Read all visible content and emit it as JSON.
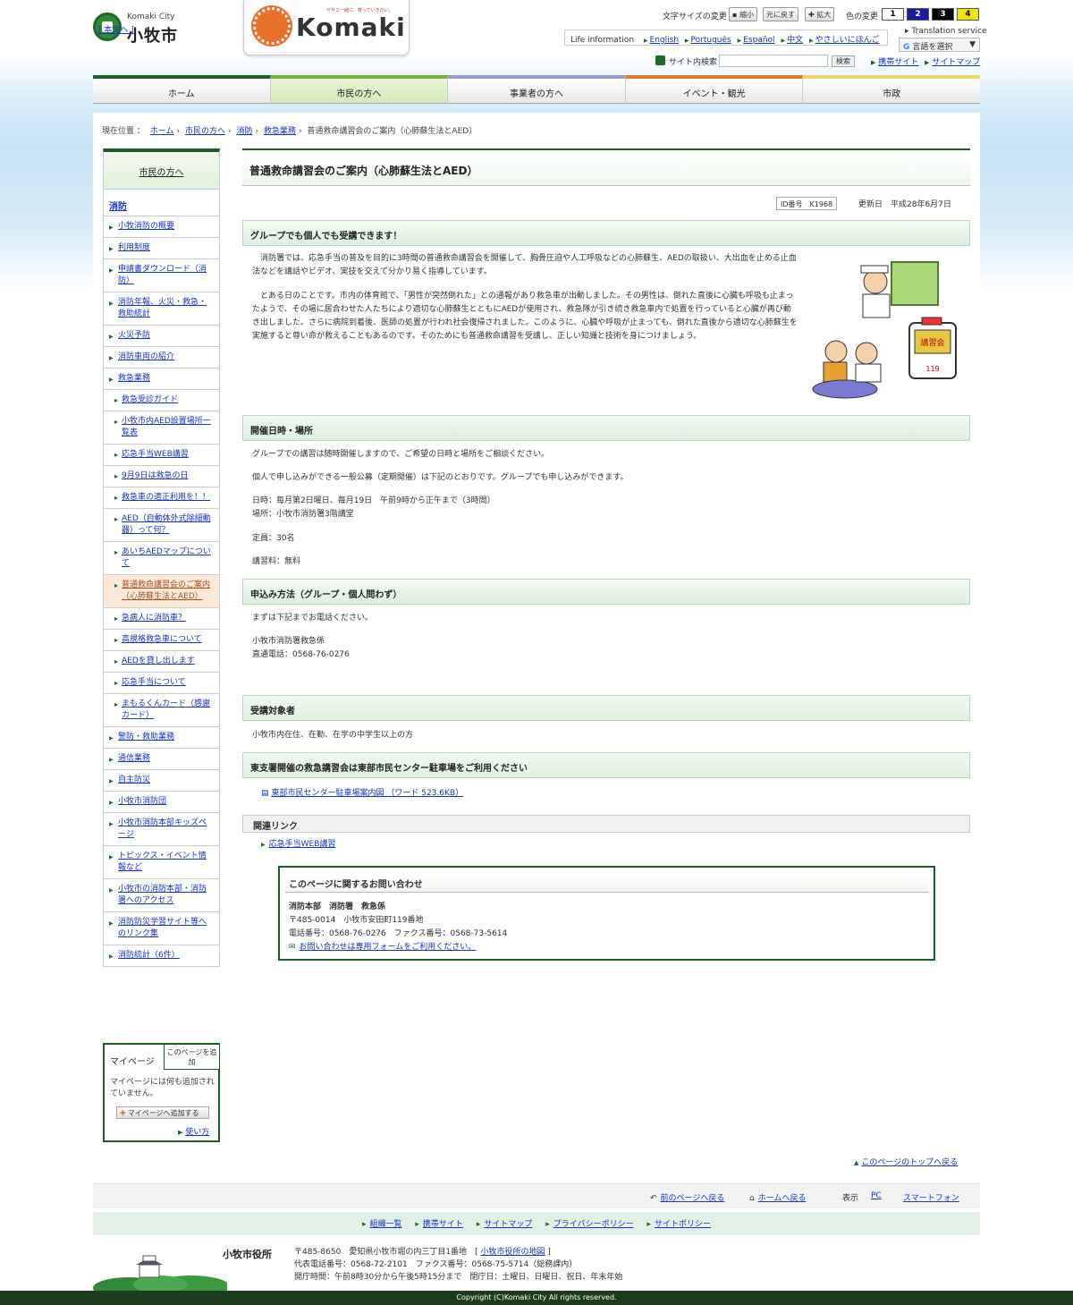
{
  "header": {
    "city_en": "Komaki City",
    "city_ja": "小牧市",
    "main_text_link": "[ 本文へ ]",
    "brand_word": "Komaki",
    "brand_tagline": "ササエ一緒に、育っていきたい。",
    "fontsize_label": "文字サイズの変更",
    "fontsize_buttons": [
      "縮小",
      "元に戻す",
      "拡大"
    ],
    "color_label": "色の変更",
    "color_buttons": [
      "1",
      "2",
      "3",
      "4"
    ],
    "lang_label": "Life information",
    "langs": [
      "English",
      "Português",
      "Español",
      "中文",
      "やさしいにほんご"
    ],
    "translation_label": "Translation service",
    "lang_select": "言語を選択",
    "search_label": "サイト内検索",
    "search_button": "検索",
    "mobile_link": "携帯サイト",
    "sitemap_link": "サイトマップ"
  },
  "gnav": [
    "ホーム",
    "市民の方へ",
    "事業者の方へ",
    "イベント・観光",
    "市政"
  ],
  "breadcrumb": {
    "label": "現在位置 ：",
    "items": [
      "ホーム",
      "市民の方へ",
      "消防",
      "救急業務"
    ],
    "current": "普通救命講習会のご案内（心肺蘇生法とAED）"
  },
  "lnav": {
    "title": "市民の方へ",
    "section": "消防",
    "items": [
      "小牧消防の概要",
      "利用制度",
      "申請書ダウンロード（消防）",
      "消防年報、火災・救急・救助統計",
      "火災予防",
      "消防車両の紹介",
      "救急業務"
    ],
    "subitems": [
      "救急受診ガイド",
      "小牧市内AED設置場所一覧表",
      "応急手当WEB講習",
      "9月9日は救急の日",
      "救急車の適正利用を！！",
      "AED（自動体外式除細動器）って何？",
      "あいちAEDマップについて",
      "普通救命講習会のご案内（心肺蘇生法とAED）",
      "急病人に消防車？",
      "高規格救急車について",
      "AEDを貸し出します",
      "応急手当について",
      "まもるくんカード（感謝カード）"
    ],
    "items2": [
      "警防・救助業務",
      "通信業務",
      "自主防災",
      "小牧市消防団",
      "小牧市消防本部キッズページ",
      "トピックス・イベント情報など",
      "小牧市の消防本部・消防署へのアクセス",
      "消防防災学習サイト等へのリンク集",
      "消防統計（6件）"
    ]
  },
  "mypage": {
    "title": "マイページ",
    "add": "このページを追加",
    "empty": "マイページには何も追加されていません。",
    "add_button": "マイページへ追加する",
    "howto": "使い方"
  },
  "main": {
    "title": "普通救命講習会のご案内（心肺蘇生法とAED）",
    "id": "ID番号　K1968",
    "updated": "更新日　平成28年6月7日",
    "h_group": "グループでも個人でも受講できます！",
    "p1": "　消防署では、応急手当の普及を目的に3時間の普通救命講習会を開催して、胸骨圧迫や人工呼吸などの心肺蘇生、AEDの取扱い、大出血を止める止血法などを講話やビデオ、実技を交えて分かり易く指導しています。",
    "p2": "　とある日のことです。市内の体育館で、「男性が突然倒れた」との通報があり救急車が出動しました。その男性は、倒れた直後に心臓も呼吸も止まったようで、その場に居合わせた人たちにより適切な心肺蘇生とともにAEDが使用され、救急隊が引き続き救急車内で処置を行っていると心臓が再び動き出しました。さらに病院到着後、医師の処置が行われ社会復帰されました。このように、心臓や呼吸が止まっても、倒れた直後から適切な心肺蘇生を実施すると尊い命が救えることもあるのです。そのためにも普通救命講習を受講し、正しい知識と技術を身につけましょう。",
    "h_datetime": "開催日時・場所",
    "p3": "グループでの講習は随時開催しますので、ご希望の日時と場所をご相談ください。",
    "p4": "個人で申し込みができる一般公募（定期開催）は下記のとおりです。グループでも申し込みができます。",
    "p5a": "日時：毎月第2日曜日、毎月19日　午前9時から正午まで（3時間）",
    "p5b": "場所：小牧市消防署3階講堂",
    "p6": "定員：30名",
    "p7": "講習料：無料",
    "h_apply": "申込み方法（グループ・個人問わず）",
    "p8": "まずは下記までお電話ください。",
    "p9a": "小牧市消防署救急係",
    "p9b": "直通電話：0568-76-0276",
    "h_target": "受講対象者",
    "p10": "小牧市内在住、在勤、在学の中学生以上の方",
    "h_parking": "東支署開催の救急講習会は東部市民センター駐車場をご利用ください",
    "doc_link": "東部市民センター駐車場案内図 （ワード 523.6KB）",
    "related_h": "関連リンク",
    "related_link": "応急手当WEB講習",
    "illust_text": "講習会"
  },
  "contact": {
    "title": "このページに関するお問い合わせ",
    "dept": "消防本部　消防署　救急係",
    "addr": "〒485-0014　小牧市安田町119番地",
    "tel": "電話番号：0568-76-0276　ファクス番号：0568-73-5614",
    "form": "お問い合わせは専用フォームをご利用ください。"
  },
  "pagetop": "このページのトップへ戻る",
  "footer": {
    "back": "前のページへ戻る",
    "home": "ホームへ戻る",
    "display": "表示",
    "pc": "PC",
    "sp": "スマートフォン",
    "links": [
      "組織一覧",
      "携帯サイト",
      "サイトマップ",
      "プライバシーポリシー",
      "サイトポリシー"
    ],
    "name": "小牧市役所",
    "addr1": "〒485-8650　愛知県小牧市堀の内三丁目1番地",
    "map_link": "小牧市役所の地図",
    "addr2": "代表電話番号：0568-72-2101　ファクス番号：0568-75-5714（総務課内）",
    "addr3": "開庁時間：午前8時30分から午後5時15分まで　閉庁日：土曜日、日曜日、祝日、年末年始",
    "copyright": "Copyright (C)Komaki City All rights reserved."
  }
}
